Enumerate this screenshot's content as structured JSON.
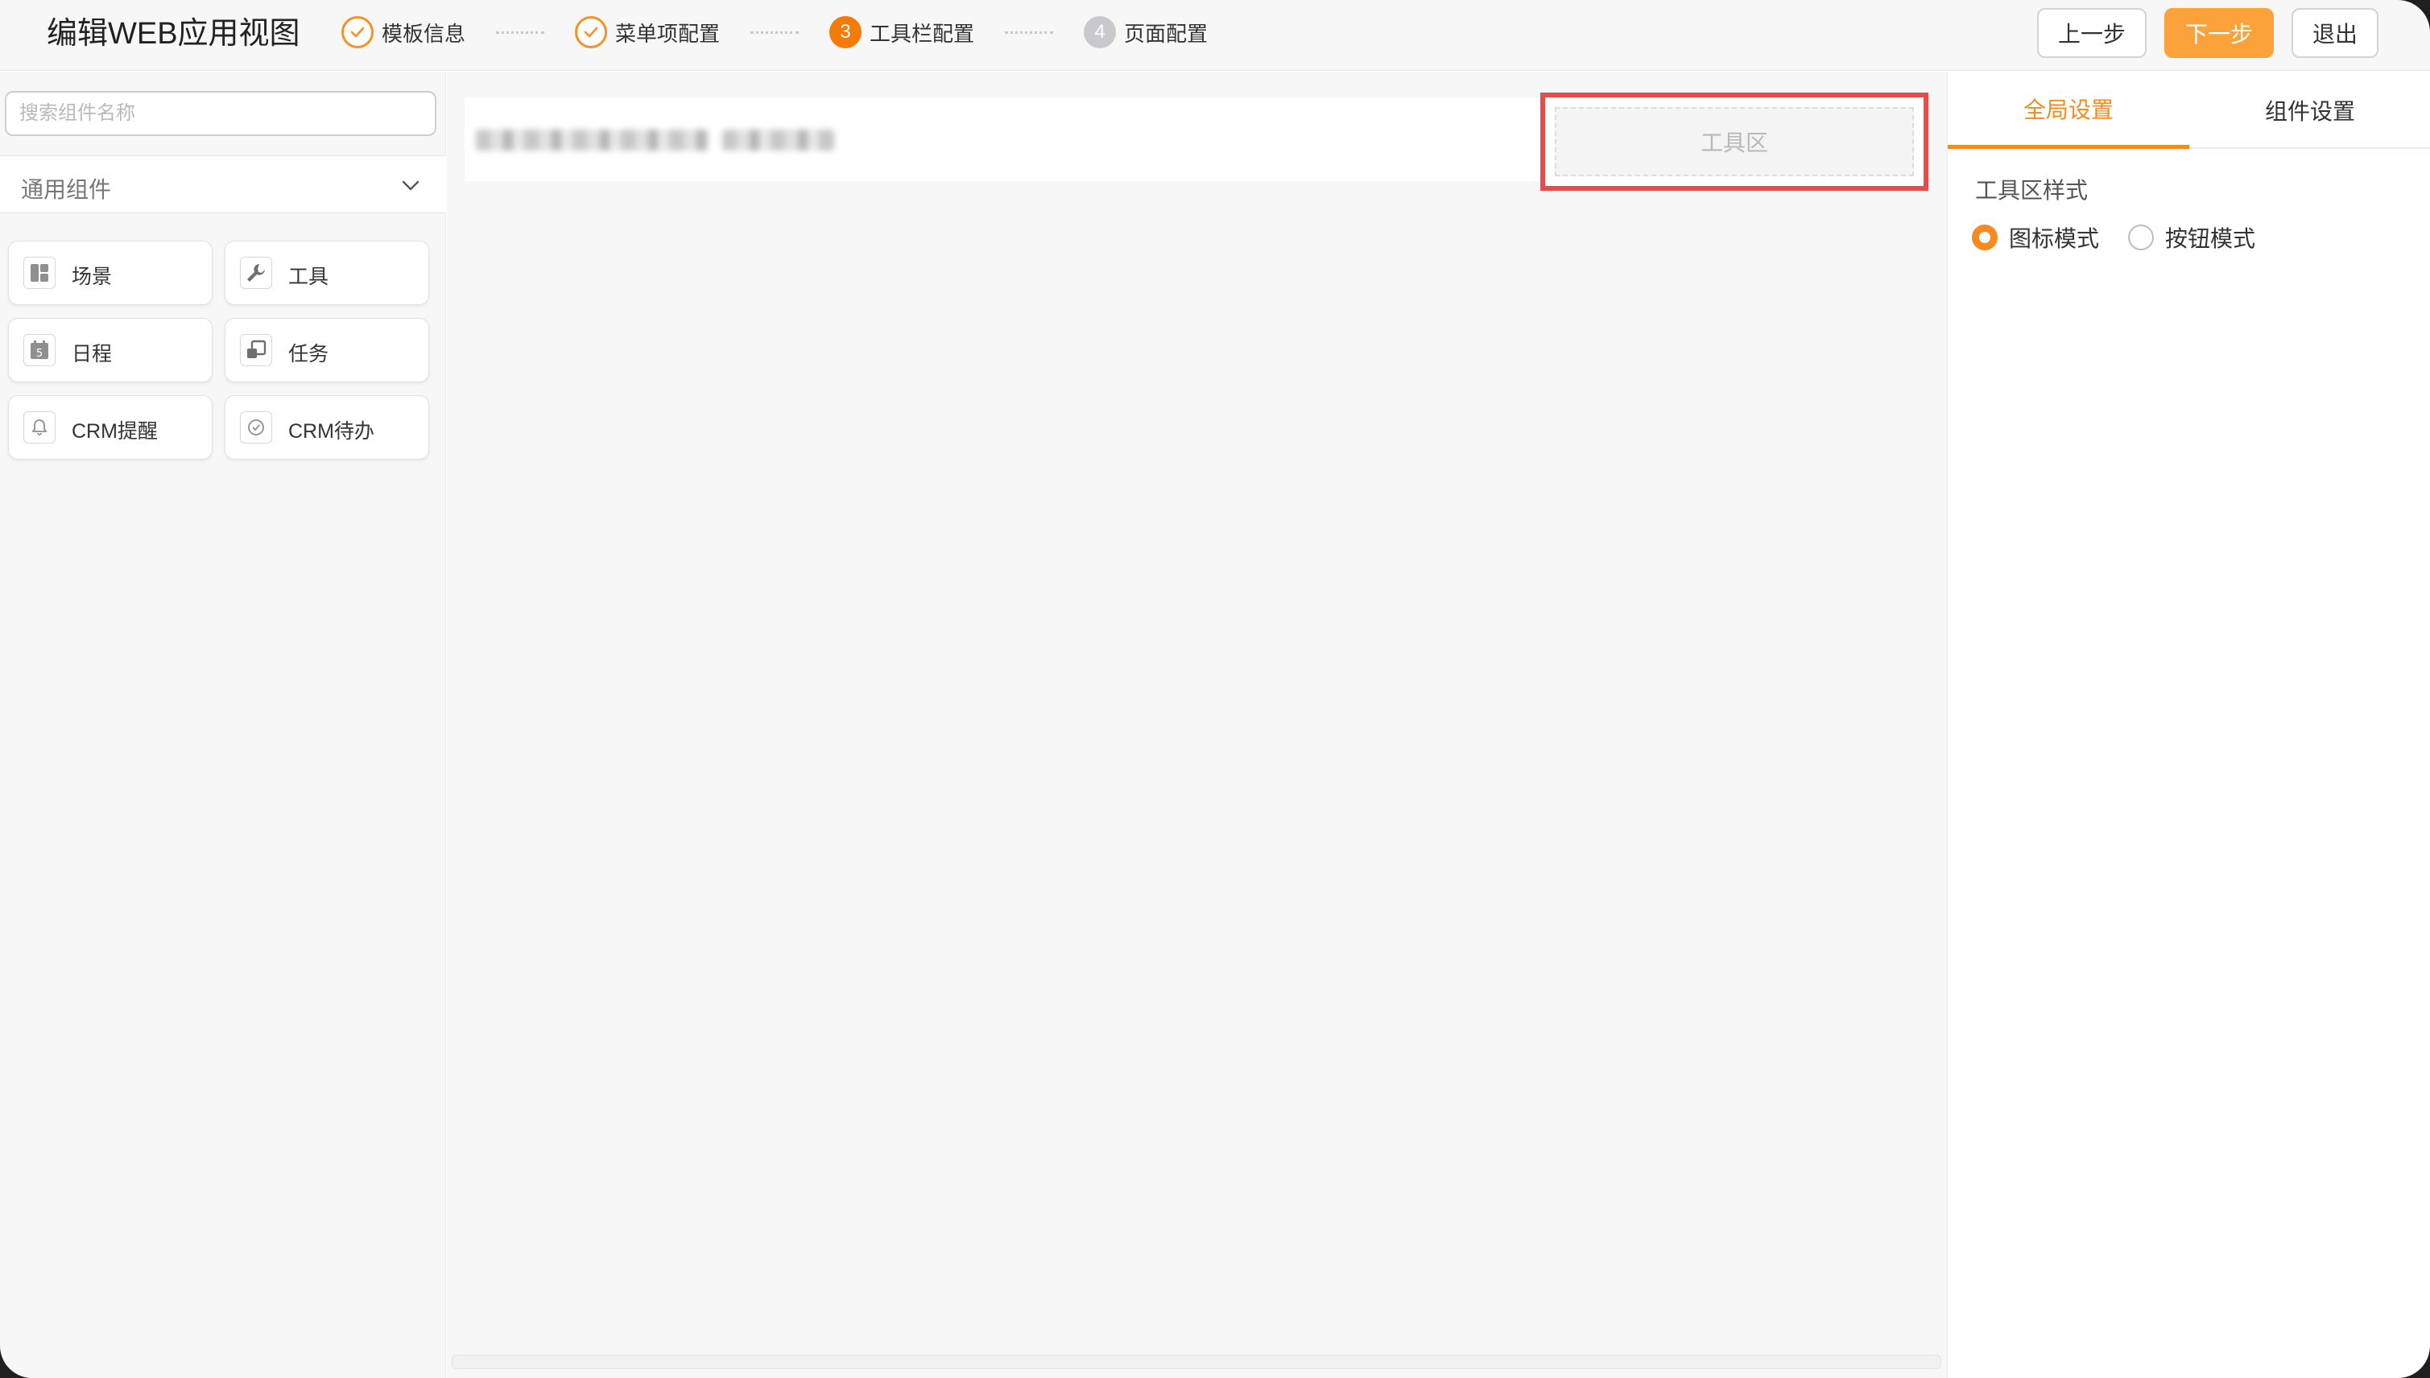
{
  "header": {
    "title": "编辑WEB应用视图",
    "steps": [
      {
        "label": "模板信息",
        "state": "done"
      },
      {
        "label": "菜单项配置",
        "state": "done"
      },
      {
        "label": "工具栏配置",
        "state": "active",
        "number": "3"
      },
      {
        "label": "页面配置",
        "state": "pending",
        "number": "4"
      }
    ],
    "buttons": {
      "prev": "上一步",
      "next": "下一步",
      "exit": "退出"
    }
  },
  "left_panel": {
    "search_placeholder": "搜索组件名称",
    "group_label": "通用组件",
    "components": [
      {
        "label": "场景",
        "icon": "layout-icon"
      },
      {
        "label": "工具",
        "icon": "wrench-icon"
      },
      {
        "label": "日程",
        "icon": "calendar-icon"
      },
      {
        "label": "任务",
        "icon": "task-icon"
      },
      {
        "label": "CRM提醒",
        "icon": "bell-icon"
      },
      {
        "label": "CRM待办",
        "icon": "check-circle-icon"
      }
    ]
  },
  "canvas": {
    "toolbar_zone_label": "工具区"
  },
  "right_panel": {
    "tabs": [
      "全局设置",
      "组件设置"
    ],
    "active_tab": "全局设置",
    "setting_label": "工具区样式",
    "options": [
      {
        "label": "图标模式",
        "checked": true
      },
      {
        "label": "按钮模式",
        "checked": false
      }
    ]
  },
  "colors": {
    "accent": "#f58a1f",
    "next_button": "#fba33a",
    "highlight_border": "#e94b4b"
  }
}
